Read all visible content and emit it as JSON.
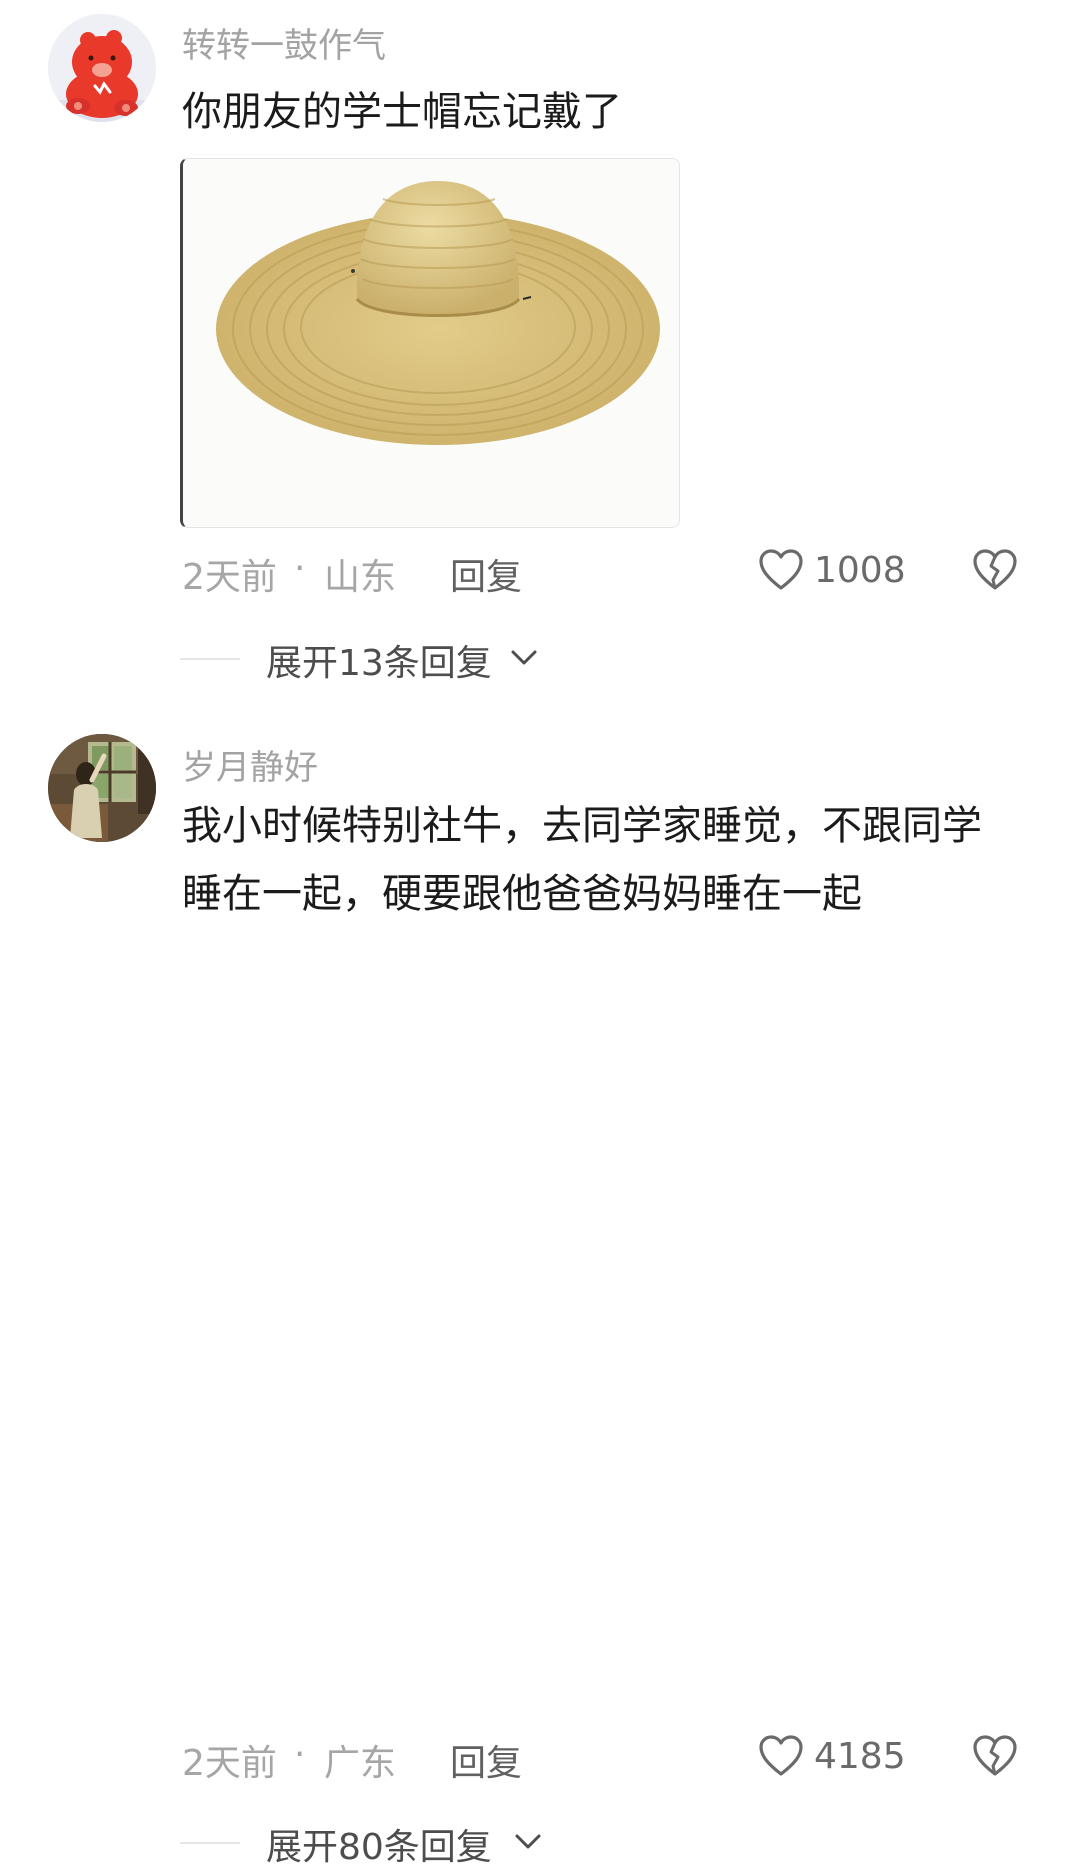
{
  "comments": [
    {
      "username": "转转一鼓作气",
      "text": "你朋友的学士帽忘记戴了",
      "time": "2天前",
      "separator": "·",
      "location": "山东",
      "reply_label": "回复",
      "likes": "1008",
      "expand_label": "展开13条回复",
      "avatar_icon": "red-bear-avatar",
      "image_icon": "straw-hat-image"
    },
    {
      "username": "岁月静好",
      "text": "我小时候特别社牛，去同学家睡觉，不跟同学睡在一起，硬要跟他爸爸妈妈睡在一起",
      "time": "2天前",
      "separator": "·",
      "location": "广东",
      "reply_label": "回复",
      "likes": "4185",
      "expand_label": "展开80条回复",
      "avatar_icon": "girl-window-photo-avatar"
    }
  ],
  "colors": {
    "username": "#a3a3a3",
    "text": "#1b1b1b",
    "meta": "#a6a6a6",
    "icon": "#6a6a6a"
  }
}
